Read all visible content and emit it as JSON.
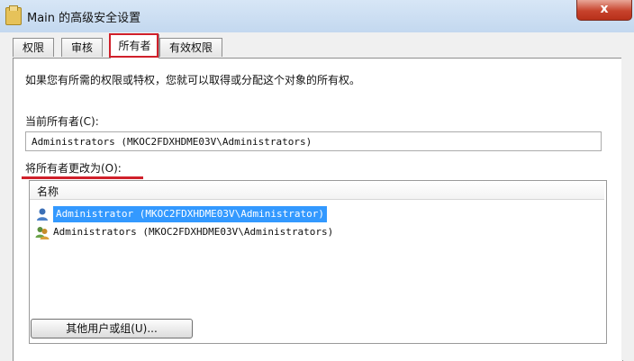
{
  "window": {
    "title": "Main 的高级安全设置",
    "close_label": "x"
  },
  "tabs": [
    {
      "label": "权限"
    },
    {
      "label": "审核"
    },
    {
      "label": "所有者"
    },
    {
      "label": "有效权限"
    }
  ],
  "active_tab": "所有者",
  "owner_tab": {
    "intro_text": "如果您有所需的权限或特权，您就可以取得或分配这个对象的所有权。",
    "current_owner_label": "当前所有者(C):",
    "current_owner_value": "Administrators (MKOC2FDXHDME03V\\Administrators)",
    "change_owner_label": "将所有者更改为(O):",
    "list": {
      "column_header": "名称",
      "rows": [
        {
          "text": "Administrator (MKOC2FDXHDME03V\\Administrator)",
          "icon": "single-user-icon",
          "selected": true
        },
        {
          "text": "Administrators (MKOC2FDXHDME03V\\Administrators)",
          "icon": "user-group-icon",
          "selected": false
        }
      ]
    },
    "other_users_button": "其他用户或组(U)..."
  },
  "colors": {
    "highlight_red": "#d0202b",
    "selection_blue": "#3399ff"
  }
}
